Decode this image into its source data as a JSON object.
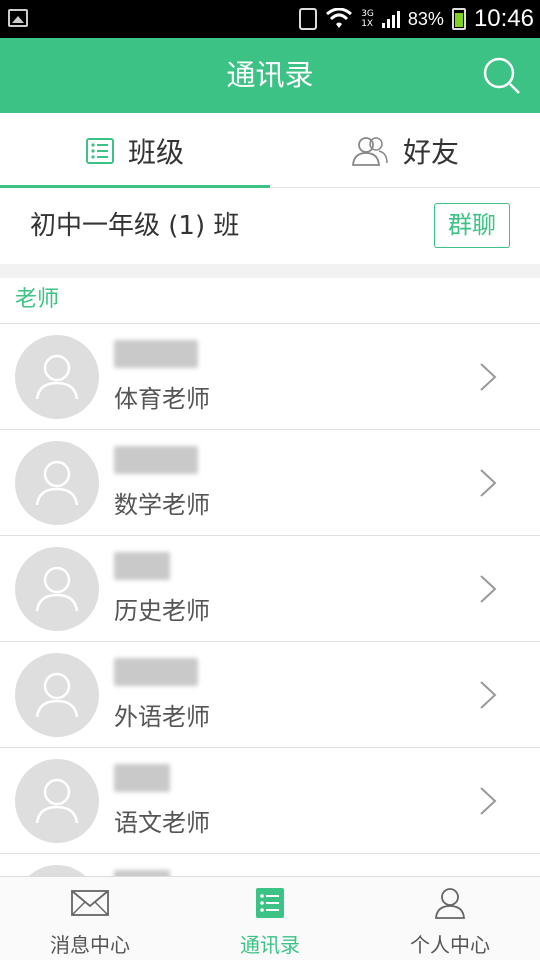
{
  "status_bar": {
    "network": "3G\n1X",
    "battery_percent": "83%",
    "time": "10:46"
  },
  "header": {
    "title": "通讯录",
    "search_icon": "search-icon"
  },
  "tabs": [
    {
      "label": "班级",
      "icon": "list-icon",
      "active": true
    },
    {
      "label": "好友",
      "icon": "friends-icon",
      "active": false
    }
  ],
  "class_row": {
    "name": "初中一年级 (1) 班",
    "group_chat_label": "群聊"
  },
  "section": {
    "title": "老师"
  },
  "contacts": [
    {
      "role": "体育老师",
      "name_blurred": true
    },
    {
      "role": "数学老师",
      "name_blurred": true
    },
    {
      "role": "历史老师",
      "name_blurred": true
    },
    {
      "role": "外语老师",
      "name_blurred": true
    },
    {
      "role": "语文老师",
      "name_blurred": true
    }
  ],
  "bottom_nav": [
    {
      "label": "消息中心",
      "icon": "mail-icon",
      "active": false
    },
    {
      "label": "通讯录",
      "icon": "contacts-list-icon",
      "active": true
    },
    {
      "label": "个人中心",
      "icon": "person-icon",
      "active": false
    }
  ],
  "colors": {
    "accent": "#3cc285",
    "status_bar": "#000000",
    "avatar_bg": "#dedede"
  }
}
